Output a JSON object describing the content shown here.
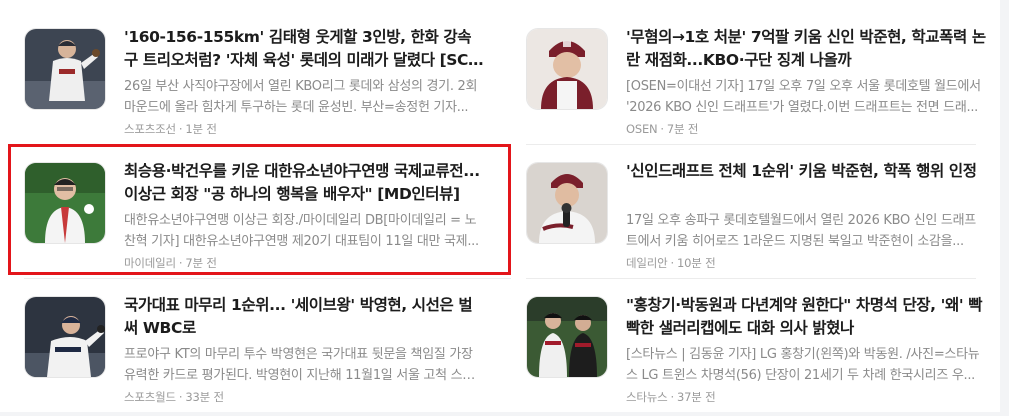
{
  "articles": [
    {
      "title": "'160-156-155km' 김태형 웃게할 3인방, 한화 강속구 트리오처럼? '자체 육성' 롯데의 미래가 달렸다 [SC포커스]",
      "summary": "26일 부산 사직야구장에서 열린 KBO리그 롯데와 삼성의 경기. 2회 마운드에 올라 힘차게 투구하는 롯데 윤성빈. 부산=송정헌 기자...",
      "source": "스포츠조선",
      "time": "1분 전"
    },
    {
      "title": "최승용·박건우를 키운 대한유소년야구연맹 국제교류전... 이상근 회장 \"공 하나의 행복을 배우자\" [MD인터뷰]",
      "summary": "대한유소년야구연맹 이상근 회장./마이데일리 DB[마이데일리 = 노찬혁 기자] 대한유소년야구연맹 제20기 대표팀이 11일 대만 국제...",
      "source": "마이데일리",
      "time": "7분 전"
    },
    {
      "title": "국가대표 마무리 1순위... '세이브왕' 박영현, 시선은 벌써 WBC로",
      "summary": "프로야구 KT의 마무리 투수 박영현은 국가대표 뒷문을 책임질 가장 유력한 카드로 평가된다. 박영현이 지난해 11월1일 서울 고척 스카이...",
      "source": "스포츠월드",
      "time": "33분 전"
    },
    {
      "title": "'무혐의→1호 처분' 7억팔 키움 신인 박준현, 학교폭력 논란 재점화...KBO·구단 징계 나올까",
      "summary": "[OSEN=이대선 기자] 17일 오후 7일 오후 서울 롯데호텔 월드에서 '2026 KBO 신인 드래프트'가 열렸다.이번 드래프트는 전면 드래...",
      "source": "OSEN",
      "time": "7분 전"
    },
    {
      "title": "'신인드래프트 전체 1순위' 키움 박준현, 학폭 행위 인정",
      "summary": "17일 오후 송파구 롯데호텔월드에서 열린 2026 KBO 신인 드래프트에서 키움 히어로즈 1라운드 지명된 북일고 박준현이 소감을...",
      "source": "데일리안",
      "time": "10분 전"
    },
    {
      "title": "\"홍창기·박동원과 다년계약 원한다\" 차명석 단장, '왜' 빡빡한 샐러리캡에도 대화 의사 밝혔나",
      "summary": "[스타뉴스 | 김동윤 기자] LG 홍창기(왼쪽)와 박동원. /사진=스타뉴스 LG 트윈스 차명석(56) 단장이 21세기 두 차례 한국시리즈 우...",
      "source": "스타뉴스",
      "time": "37분 전"
    }
  ],
  "meta_separator": "·",
  "highlight_color": "#e3151a"
}
